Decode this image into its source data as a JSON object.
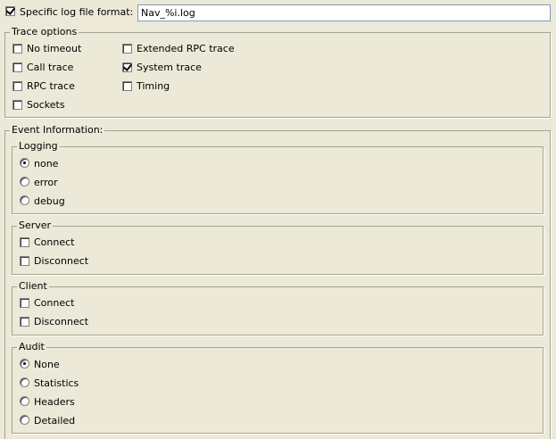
{
  "log_format": {
    "label": "Specific log file format:",
    "checked": true,
    "value": "Nav_%i.log"
  },
  "trace_options": {
    "title": "Trace options",
    "no_timeout": {
      "label": "No timeout",
      "checked": false
    },
    "call_trace": {
      "label": "Call trace",
      "checked": false
    },
    "rpc_trace": {
      "label": "RPC trace",
      "checked": false
    },
    "sockets": {
      "label": "Sockets",
      "checked": false
    },
    "extended_rpc_trace": {
      "label": "Extended RPC trace",
      "checked": false
    },
    "system_trace": {
      "label": "System trace",
      "checked": true
    },
    "timing": {
      "label": "Timing",
      "checked": false
    }
  },
  "event_information": {
    "title": "Event Information:",
    "logging": {
      "title": "Logging",
      "none": {
        "label": "none",
        "selected": true
      },
      "error": {
        "label": "error",
        "selected": false
      },
      "debug": {
        "label": "debug",
        "selected": false
      }
    },
    "server": {
      "title": "Server",
      "connect": {
        "label": "Connect",
        "checked": false
      },
      "disconnect": {
        "label": "Disconnect",
        "checked": false
      }
    },
    "client": {
      "title": "Client",
      "connect": {
        "label": "Connect",
        "checked": false
      },
      "disconnect": {
        "label": "Disconnect",
        "checked": false
      }
    },
    "audit": {
      "title": "Audit",
      "none": {
        "label": "None",
        "selected": true
      },
      "statistics": {
        "label": "Statistics",
        "selected": false
      },
      "headers": {
        "label": "Headers",
        "selected": false
      },
      "detailed": {
        "label": "Detailed",
        "selected": false
      }
    }
  }
}
